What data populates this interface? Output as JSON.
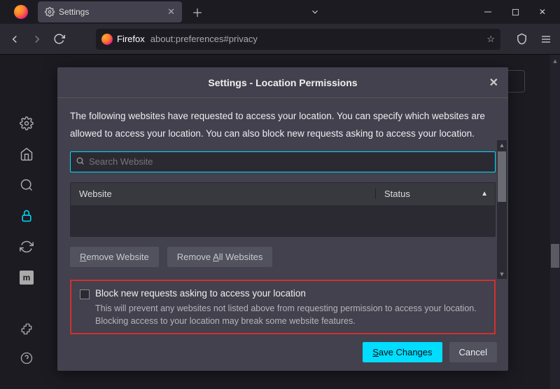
{
  "tab": {
    "label": "Settings"
  },
  "url": {
    "prefix": "Firefox",
    "path": "about:preferences#privacy"
  },
  "dialog": {
    "title": "Settings - Location Permissions",
    "description": "The following websites have requested to access your location. You can specify which websites are allowed to access your location. You can also block new requests asking to access your location.",
    "search_placeholder": "Search Website",
    "col_website": "Website",
    "col_status": "Status",
    "remove_one": "Remove Website",
    "remove_all": "Remove All Websites",
    "block_label": "Block new requests asking to access your location",
    "block_hint": "This will prevent any websites not listed above from requesting permission to access your location. Blocking access to your location may break some website features.",
    "save": "Save Changes",
    "cancel": "Cancel"
  }
}
